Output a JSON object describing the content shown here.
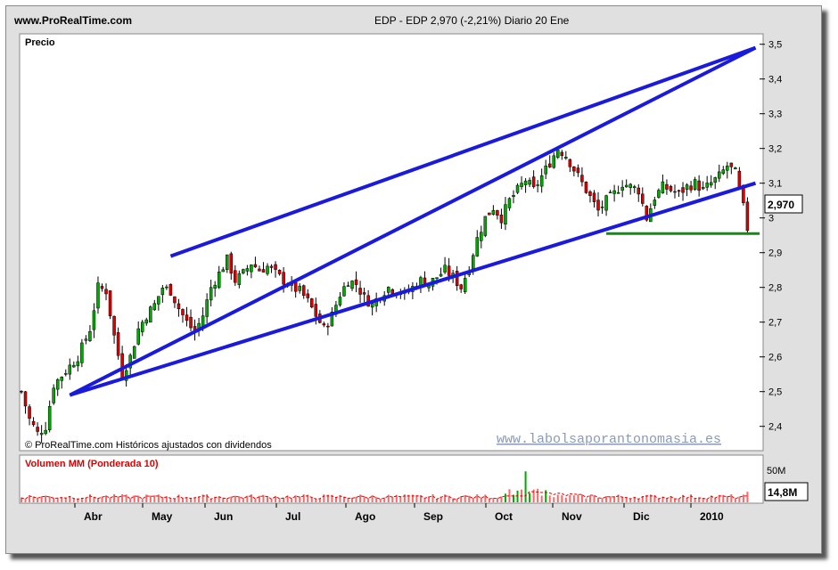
{
  "header": {
    "site": "www.ProRealTime.com",
    "quote": "EDP - EDP   2,970 (-2,21%)   Diario  20 Ene"
  },
  "price_panel": {
    "label": "Precio",
    "copyright": "© ProRealTime.com  Históricos ajustados con dividendos",
    "watermark": "www.labolsaporantonomasia.es",
    "last_price": "2,970"
  },
  "volume_panel": {
    "label": "Volumen MM (Ponderada 10)",
    "axis_label": "50M",
    "last_volume": "14,8M"
  },
  "colors": {
    "candle_up": "#00aa00",
    "candle_down": "#dd0000",
    "channel": "#1a1adc",
    "support": "#138a13",
    "volume": "#ff6666",
    "volume_ma": "#dd0000",
    "watermark": "#8a9ab8"
  },
  "chart_data": {
    "type": "line",
    "title": "EDP - EDP 2,970 (-2,21%) Diario 20 Ene",
    "x_axis": [
      "Abr",
      "May",
      "Jun",
      "Jul",
      "Ago",
      "Sep",
      "Oct",
      "Nov",
      "Dic",
      "2010"
    ],
    "y_ticks": [
      "3,5",
      "3,4",
      "3,3",
      "3,2",
      "3,1",
      "3",
      "2,9",
      "2,8",
      "2,7",
      "2,6",
      "2,5",
      "2,4"
    ],
    "ylim": [
      2.33,
      3.53
    ],
    "series": [
      {
        "points": [
          [
            0,
            2.5
          ],
          [
            2,
            2.42
          ],
          [
            4,
            2.38
          ],
          [
            6,
            2.4
          ],
          [
            8,
            2.52
          ],
          [
            11,
            2.56
          ],
          [
            14,
            2.6
          ],
          [
            17,
            2.68
          ],
          [
            19,
            2.8
          ],
          [
            21,
            2.79
          ],
          [
            23,
            2.66
          ],
          [
            25,
            2.55
          ],
          [
            27,
            2.6
          ],
          [
            29,
            2.68
          ],
          [
            31,
            2.72
          ],
          [
            33,
            2.75
          ],
          [
            35,
            2.8
          ],
          [
            37,
            2.79
          ],
          [
            39,
            2.74
          ],
          [
            41,
            2.7
          ],
          [
            43,
            2.67
          ],
          [
            45,
            2.72
          ],
          [
            47,
            2.8
          ],
          [
            49,
            2.84
          ],
          [
            51,
            2.88
          ],
          [
            53,
            2.82
          ],
          [
            55,
            2.84
          ],
          [
            57,
            2.87
          ],
          [
            59,
            2.85
          ],
          [
            61,
            2.86
          ],
          [
            63,
            2.84
          ],
          [
            65,
            2.82
          ],
          [
            67,
            2.8
          ],
          [
            69,
            2.79
          ],
          [
            71,
            2.76
          ],
          [
            73,
            2.72
          ],
          [
            75,
            2.68
          ],
          [
            77,
            2.72
          ],
          [
            79,
            2.78
          ],
          [
            81,
            2.82
          ],
          [
            83,
            2.81
          ],
          [
            85,
            2.77
          ],
          [
            87,
            2.75
          ],
          [
            89,
            2.78
          ],
          [
            91,
            2.8
          ],
          [
            93,
            2.79
          ],
          [
            95,
            2.78
          ],
          [
            97,
            2.8
          ],
          [
            99,
            2.82
          ],
          [
            101,
            2.81
          ],
          [
            103,
            2.83
          ],
          [
            105,
            2.85
          ],
          [
            107,
            2.83
          ],
          [
            109,
            2.8
          ],
          [
            111,
            2.86
          ],
          [
            113,
            2.94
          ],
          [
            115,
            3.0
          ],
          [
            117,
            3.03
          ],
          [
            119,
            3.0
          ],
          [
            121,
            3.05
          ],
          [
            123,
            3.08
          ],
          [
            125,
            3.11
          ],
          [
            127,
            3.08
          ],
          [
            129,
            3.12
          ],
          [
            131,
            3.16
          ],
          [
            133,
            3.2
          ],
          [
            135,
            3.18
          ],
          [
            137,
            3.14
          ],
          [
            139,
            3.1
          ],
          [
            141,
            3.06
          ],
          [
            143,
            3.02
          ],
          [
            145,
            3.05
          ],
          [
            147,
            3.07
          ],
          [
            149,
            3.1
          ],
          [
            151,
            3.09
          ],
          [
            153,
            3.08
          ],
          [
            155,
            3.0
          ],
          [
            157,
            3.06
          ],
          [
            159,
            3.09
          ],
          [
            161,
            3.08
          ],
          [
            163,
            3.07
          ],
          [
            165,
            3.09
          ],
          [
            167,
            3.1
          ],
          [
            169,
            3.08
          ],
          [
            171,
            3.1
          ],
          [
            173,
            3.12
          ],
          [
            175,
            3.15
          ],
          [
            177,
            3.13
          ],
          [
            178,
            3.08
          ],
          [
            179,
            3.03
          ],
          [
            180,
            2.97
          ]
        ]
      }
    ],
    "annotations": [
      {
        "type": "trendline",
        "color": "channel",
        "from": [
          12,
          2.49
        ],
        "to": [
          182,
          3.49
        ]
      },
      {
        "type": "trendline",
        "color": "channel",
        "from": [
          37,
          2.89
        ],
        "to": [
          182,
          3.49
        ]
      },
      {
        "type": "trendline",
        "color": "channel",
        "from": [
          12,
          2.49
        ],
        "to": [
          182,
          3.1
        ]
      },
      {
        "type": "hline",
        "color": "support",
        "y": 2.955,
        "from_x": 145
      }
    ],
    "volume": {
      "axis_max": 50,
      "unit": "M",
      "last": 14.8,
      "spike_index": 125,
      "spike_value": 53
    }
  }
}
